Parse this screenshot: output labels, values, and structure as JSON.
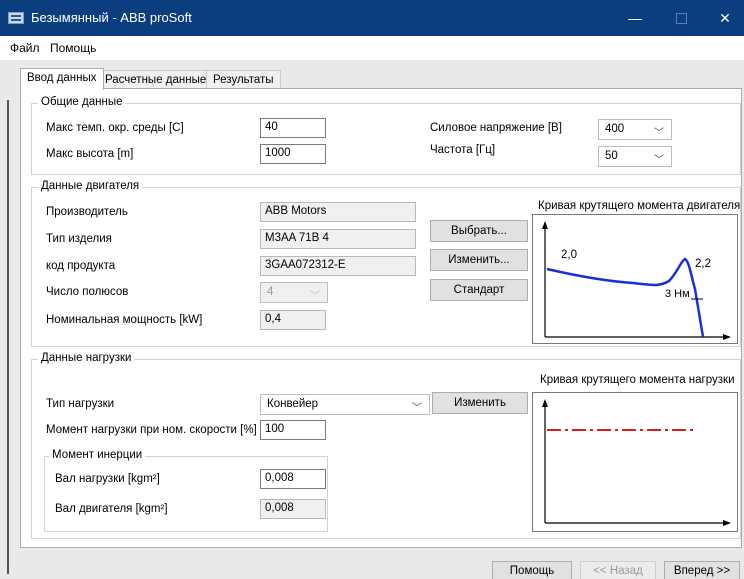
{
  "window": {
    "title": "Безымянный - ABB proSoft",
    "min": "—",
    "close": "✕"
  },
  "menu": [
    "Файл",
    "Помощь"
  ],
  "tabs": [
    "Ввод данных",
    "Расчетные данные",
    "Результаты"
  ],
  "general": {
    "title": "Общие данные",
    "max_temp_label": "Макс темп. окр. среды [C]",
    "max_temp_value": "40",
    "max_alt_label": "Макс высота [m]",
    "max_alt_value": "1000",
    "voltage_label": "Силовое напряжение [B]",
    "voltage_value": "400",
    "freq_label": "Частота [Гц]",
    "freq_value": "50"
  },
  "motor": {
    "title": "Данные двигателя",
    "manufacturer_label": "Производитель",
    "manufacturer_value": "ABB Motors",
    "type_label": "Тип изделия",
    "type_value": "M3AA 71B 4",
    "code_label": "код продукта",
    "code_value": "3GAA072312-E",
    "poles_label": "Число полюсов",
    "poles_value": "4",
    "power_label": "Номинальная мощность [kW]",
    "power_value": "0,4",
    "select_btn": "Выбрать...",
    "edit_btn": "Изменить...",
    "standard_btn": "Стандарт",
    "curve_title": "Кривая крутящего момента двигателя",
    "curve_labels": {
      "start": "2,0",
      "peak": "2,2",
      "load": "3 Нм"
    }
  },
  "load": {
    "title": "Данные нагрузки",
    "type_label": "Тип нагрузки",
    "type_value": "Конвейер",
    "edit_btn": "Изменить",
    "torque_label": "Момент нагрузки при ном. скорости [%]",
    "torque_value": "100",
    "inertia_title": "Момент инерции",
    "load_shaft_label": "Вал нагрузки [kgm²]",
    "load_shaft_value": "0,008",
    "motor_shaft_label": "Вал двигателя [kgm²]",
    "motor_shaft_value": "0,008",
    "curve_title": "Кривая крутящего момента нагрузки"
  },
  "footer": {
    "help_btn": "Помощь",
    "back_btn": "<< Назад",
    "next_btn": "Вперед >>"
  },
  "colors": {
    "titlebar": "#0b3e7e",
    "curve": "#1a2fd6",
    "load_curve": "#d62020"
  },
  "icons": [
    "app-icon",
    "minimize-icon",
    "maximize-icon",
    "close-icon",
    "chevron-down-icon"
  ]
}
